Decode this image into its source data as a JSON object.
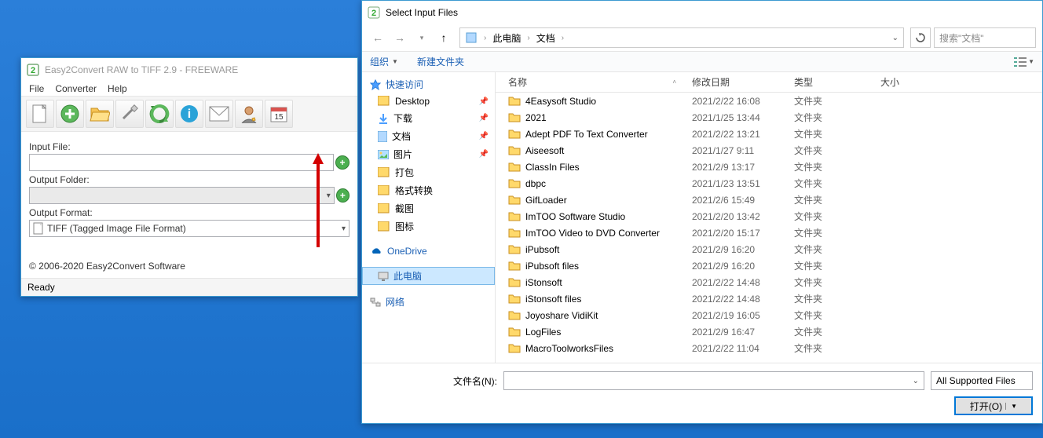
{
  "mainwin": {
    "title": "Easy2Convert RAW to TIFF 2.9 - FREEWARE",
    "menu": [
      "File",
      "Converter",
      "Help"
    ],
    "input_file_label": "Input File:",
    "output_folder_label": "Output Folder:",
    "output_format_label": "Output Format:",
    "output_format_value": "TIFF (Tagged Image File Format)",
    "copyright": "© 2006-2020 Easy2Convert Software",
    "status": "Ready"
  },
  "dialog": {
    "title": "Select Input Files",
    "breadcrumb": {
      "root": "此电脑",
      "folder": "文档"
    },
    "search_placeholder": "搜索\"文档\"",
    "organize": "组织",
    "newfolder": "新建文件夹",
    "columns": {
      "name": "名称",
      "date": "修改日期",
      "type": "类型",
      "size": "大小"
    },
    "nav": {
      "quick": "快速访问",
      "desktop": "Desktop",
      "downloads": "下载",
      "documents": "文档",
      "pictures": "图片",
      "packages": "打包",
      "format": "格式转换",
      "screenshot": "截图",
      "icons": "图标",
      "onedrive": "OneDrive",
      "thispc": "此电脑",
      "network": "网络"
    },
    "files": [
      {
        "name": "4Easysoft Studio",
        "date": "2021/2/22 16:08",
        "type": "文件夹"
      },
      {
        "name": "2021",
        "date": "2021/1/25 13:44",
        "type": "文件夹"
      },
      {
        "name": "Adept PDF To Text Converter",
        "date": "2021/2/22 13:21",
        "type": "文件夹"
      },
      {
        "name": "Aiseesoft",
        "date": "2021/1/27 9:11",
        "type": "文件夹"
      },
      {
        "name": "ClassIn Files",
        "date": "2021/2/9 13:17",
        "type": "文件夹"
      },
      {
        "name": "dbpc",
        "date": "2021/1/23 13:51",
        "type": "文件夹"
      },
      {
        "name": "GifLoader",
        "date": "2021/2/6 15:49",
        "type": "文件夹"
      },
      {
        "name": "ImTOO Software Studio",
        "date": "2021/2/20 13:42",
        "type": "文件夹"
      },
      {
        "name": "ImTOO Video to DVD Converter",
        "date": "2021/2/20 15:17",
        "type": "文件夹"
      },
      {
        "name": "iPubsoft",
        "date": "2021/2/9 16:20",
        "type": "文件夹"
      },
      {
        "name": "iPubsoft files",
        "date": "2021/2/9 16:20",
        "type": "文件夹"
      },
      {
        "name": "iStonsoft",
        "date": "2021/2/22 14:48",
        "type": "文件夹"
      },
      {
        "name": "iStonsoft files",
        "date": "2021/2/22 14:48",
        "type": "文件夹"
      },
      {
        "name": "Joyoshare VidiKit",
        "date": "2021/2/19 16:05",
        "type": "文件夹"
      },
      {
        "name": "LogFiles",
        "date": "2021/2/9 16:47",
        "type": "文件夹"
      },
      {
        "name": "MacroToolworksFiles",
        "date": "2021/2/22 11:04",
        "type": "文件夹"
      }
    ],
    "filename_label": "文件名(N):",
    "filter": "All Supported Files",
    "open_btn": "打开(O)"
  }
}
